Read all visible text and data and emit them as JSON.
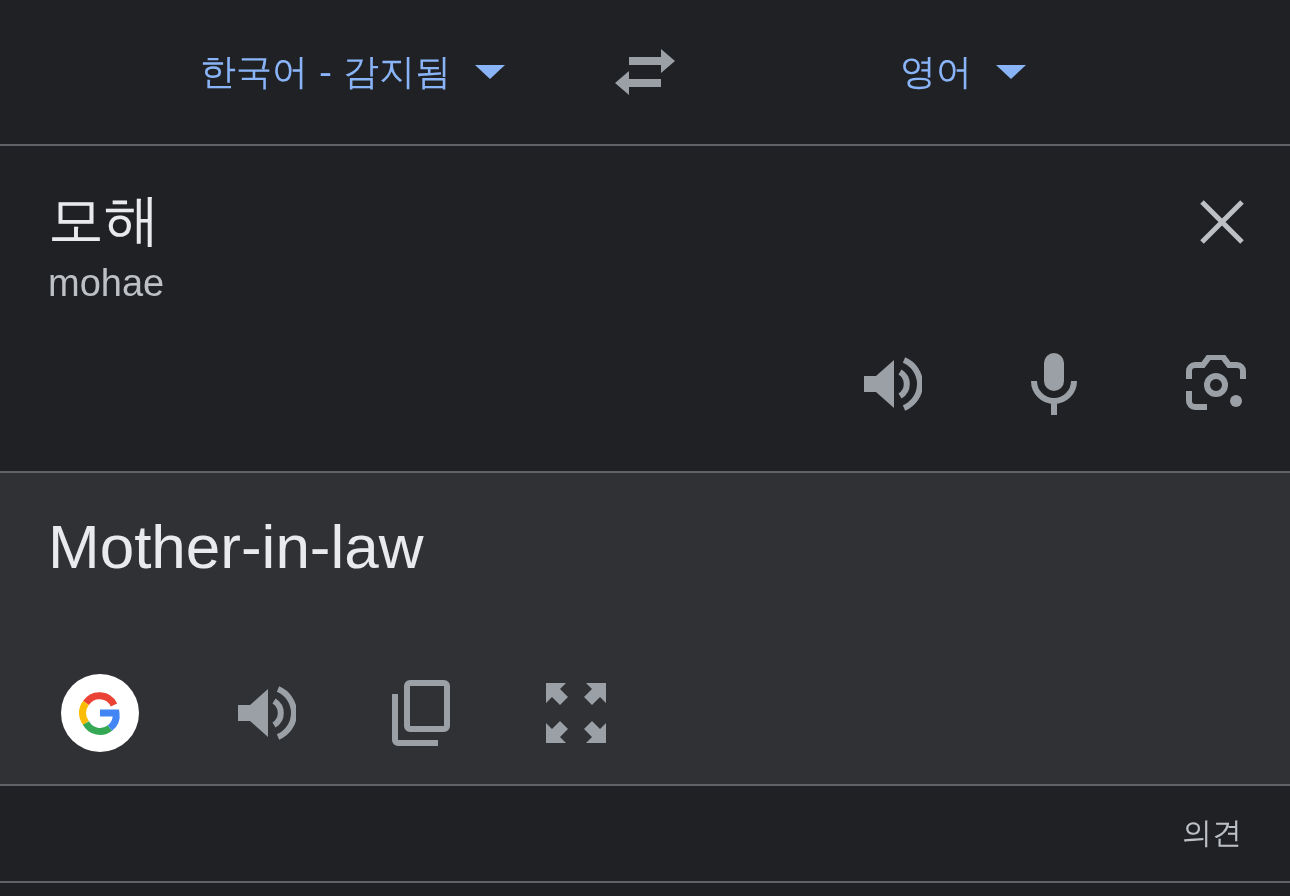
{
  "languages": {
    "source": {
      "label": "한국어 - 감지됨"
    },
    "target": {
      "label": "영어"
    }
  },
  "source": {
    "text": "모해",
    "romanization": "mohae"
  },
  "result": {
    "text": "Mother-in-law"
  },
  "footer": {
    "feedback": "의견"
  }
}
